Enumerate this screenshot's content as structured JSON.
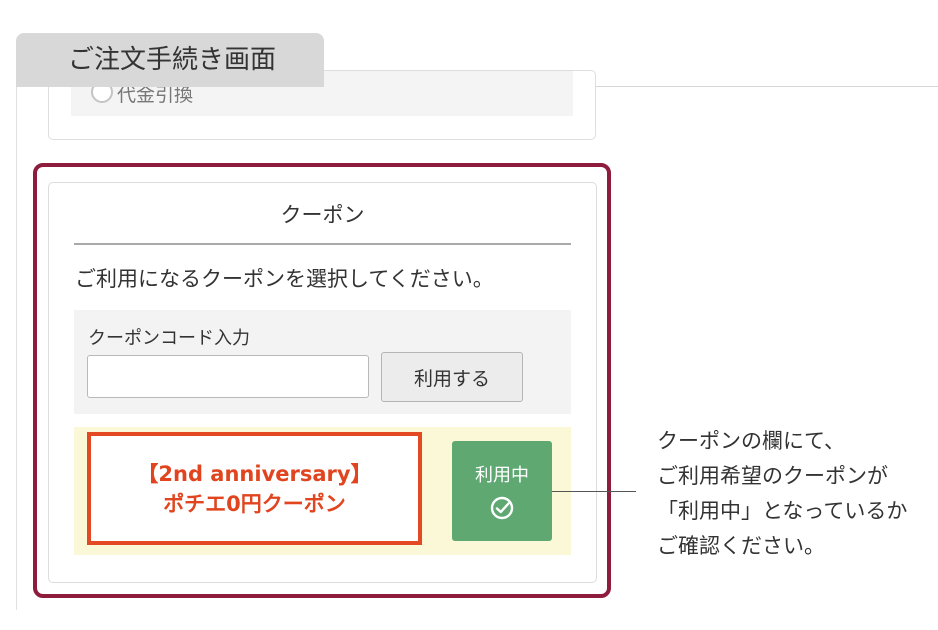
{
  "header": {
    "tab_title": "ご注文手続き画面"
  },
  "previous_section": {
    "option_label": "代金引換"
  },
  "coupon": {
    "title": "クーポン",
    "instruction": "ご利用になるクーポンを選択してください。",
    "code_label": "クーポンコード入力",
    "code_value": "",
    "code_placeholder": "",
    "apply_button_label": "利用する",
    "applied": {
      "name_line1": "【2nd anniversary】",
      "name_line2": "ポチエ0円クーポン",
      "status_label": "利用中",
      "status_icon": "check-circle-icon"
    }
  },
  "callout": {
    "lines": [
      "クーポンの欄にて、",
      "ご利用希望のクーポンが",
      "「利用中」となっているか",
      "ご確認ください。"
    ]
  },
  "colors": {
    "highlight_border": "#8e1d3d",
    "coupon_name_border": "#e34a24",
    "coupon_name_text": "#e0451f",
    "status_badge": "#5fa872",
    "applied_row_bg": "#fbf8d8",
    "tab_bg": "#d8d8d8"
  }
}
